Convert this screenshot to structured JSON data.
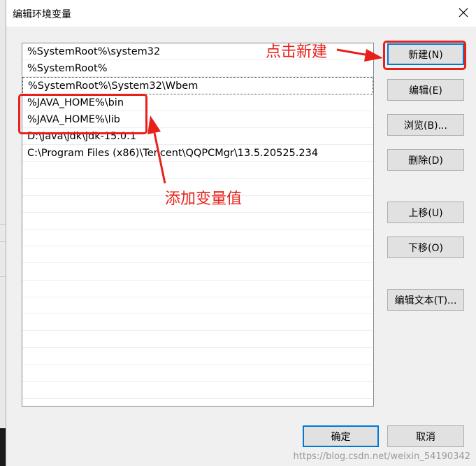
{
  "window": {
    "title": "编辑环境变量"
  },
  "path_entries": [
    "%SystemRoot%\\system32",
    "%SystemRoot%",
    "%SystemRoot%\\System32\\Wbem",
    "%JAVA_HOME%\\bin",
    "%JAVA_HOME%\\lib",
    "D:\\Java\\jdk\\jdk-15.0.1",
    "C:\\Program Files (x86)\\Tencent\\QQPCMgr\\13.5.20525.234"
  ],
  "buttons": {
    "new": "新建(N)",
    "edit": "编辑(E)",
    "browse": "浏览(B)...",
    "delete": "删除(D)",
    "move_up": "上移(U)",
    "move_down": "下移(O)",
    "edit_text": "编辑文本(T)...",
    "ok": "确定",
    "cancel": "取消"
  },
  "annotations": {
    "click_new": "点击新建",
    "add_value": "添加变量值",
    "color": "#e8201a"
  },
  "watermark": "https://blog.csdn.net/weixin_54190342"
}
